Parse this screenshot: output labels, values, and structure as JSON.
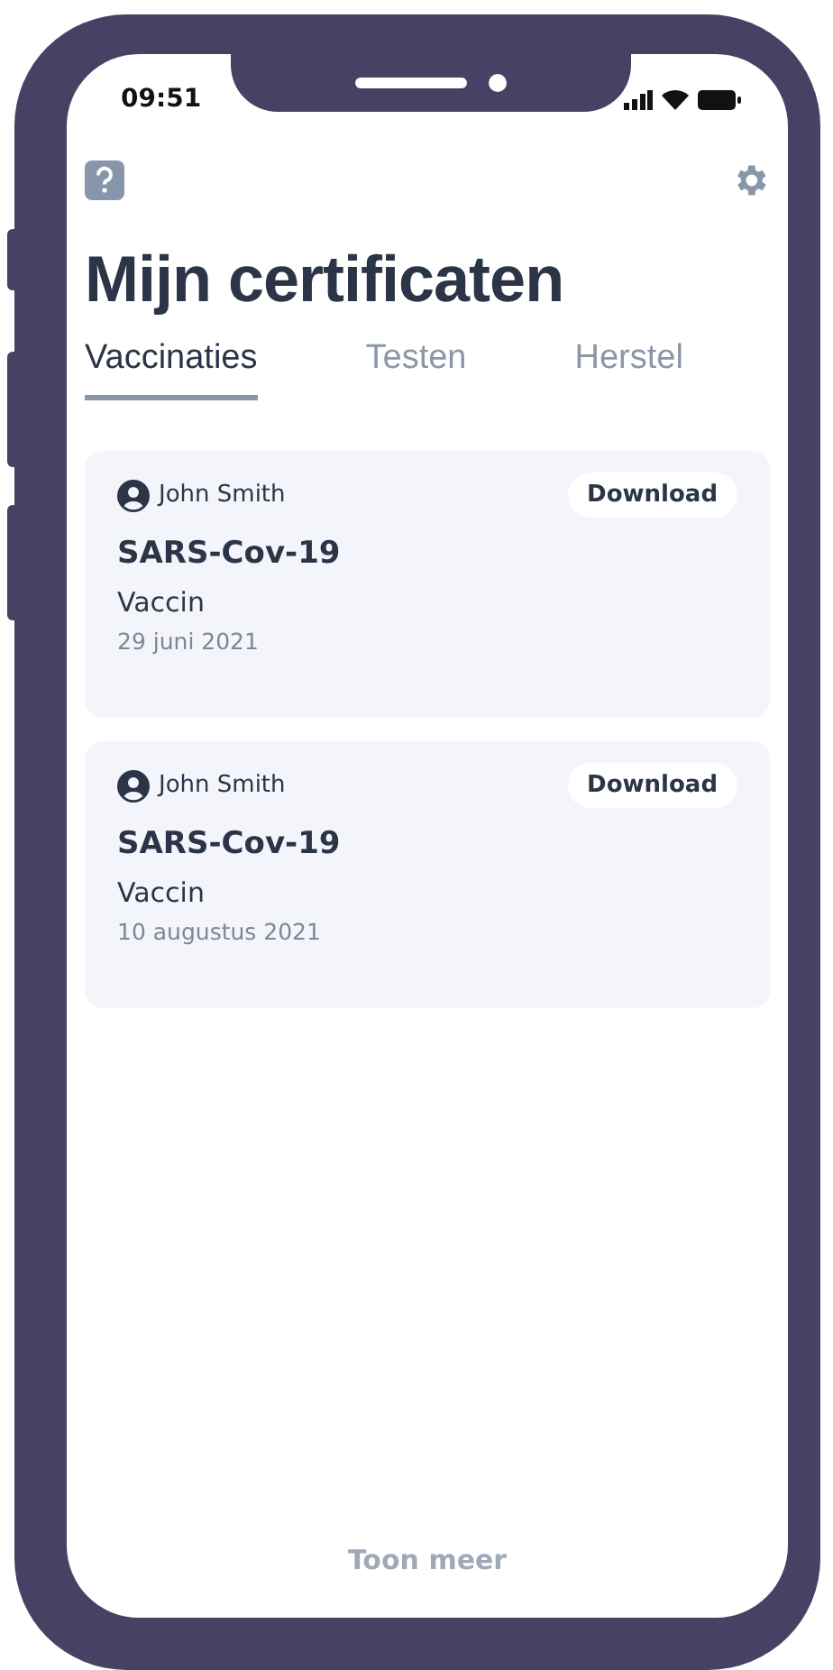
{
  "status_bar": {
    "time": "09:51"
  },
  "title": "Mijn certificaten",
  "tabs": [
    {
      "label": "Vaccinaties",
      "selected": true
    },
    {
      "label": "Testen",
      "selected": false
    },
    {
      "label": "Herstel",
      "selected": false
    }
  ],
  "certificates": [
    {
      "holder": "John Smith",
      "action": "Download",
      "name": "SARS-Cov-19",
      "type": "Vaccin",
      "date": "29 juni 2021"
    },
    {
      "holder": "John Smith",
      "action": "Download",
      "name": "SARS-Cov-19",
      "type": "Vaccin",
      "date": "10 augustus 2021"
    }
  ],
  "footer_link": "Toon meer"
}
